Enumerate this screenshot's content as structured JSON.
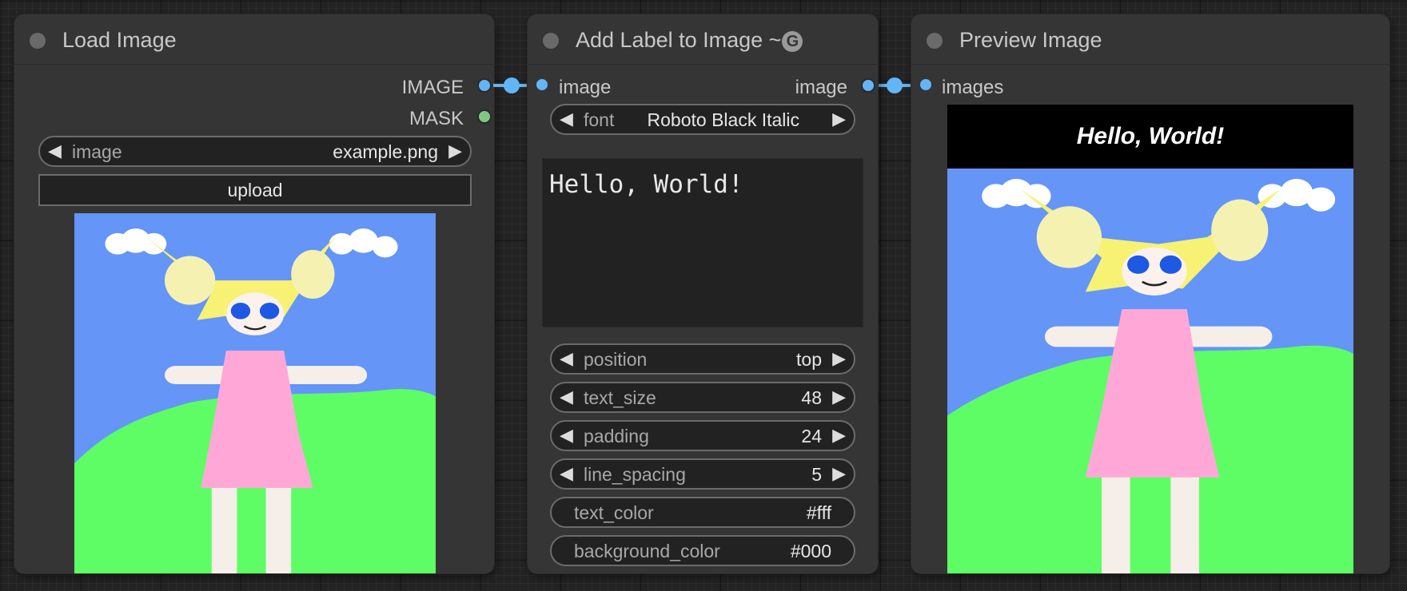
{
  "colors": {
    "image_slot": "#64b5f6",
    "mask_slot": "#81c784",
    "node_bg": "#353535",
    "widget_bg": "#222222"
  },
  "nodes": {
    "load_image": {
      "title": "Load Image",
      "outputs": {
        "image": "IMAGE",
        "mask": "MASK"
      },
      "image_widget": {
        "name": "image",
        "value": "example.png"
      },
      "upload_label": "upload"
    },
    "add_label": {
      "title": "Add Label to Image ~",
      "badge_icon": "g-badge-icon",
      "input_label": "image",
      "output_label": "image",
      "font_widget": {
        "name": "font",
        "value": "Roboto Black Italic"
      },
      "text": "Hello, World!",
      "widgets": [
        {
          "name": "position",
          "value": "top"
        },
        {
          "name": "text_size",
          "value": "48"
        },
        {
          "name": "padding",
          "value": "24"
        },
        {
          "name": "line_spacing",
          "value": "5"
        },
        {
          "name": "text_color",
          "value": "#fff"
        },
        {
          "name": "background_color",
          "value": "#000"
        }
      ]
    },
    "preview_image": {
      "title": "Preview Image",
      "input_label": "images",
      "label_text": "Hello, World!"
    }
  }
}
